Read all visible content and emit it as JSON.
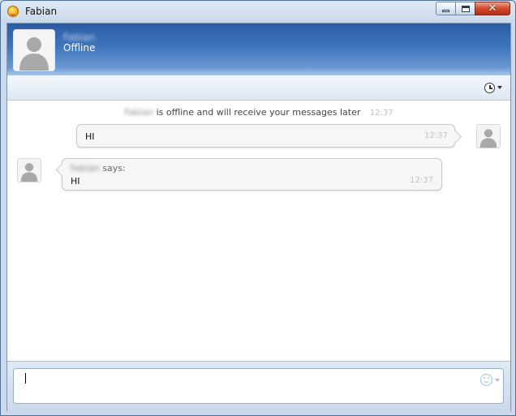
{
  "window": {
    "title": "Fabian",
    "app_icon": "smiley-emoticon-icon",
    "controls": [
      "minimize-icon",
      "maximize-icon",
      "close-icon"
    ]
  },
  "contact": {
    "name": "Fabian",
    "status": "Offline"
  },
  "toolbar": {
    "history_icon": "clock-history-icon"
  },
  "conversation": {
    "system_notice": {
      "name": "Fabian",
      "text": "is offline and will receive your messages later",
      "time": "12:37"
    },
    "outgoing": {
      "text": "HI",
      "time": "12:37"
    },
    "incoming": {
      "sender": "Fabian",
      "says": "says:",
      "text": "HI",
      "time": "12:37"
    }
  },
  "input": {
    "value": "",
    "emoticon_icon": "emoticon-picker-icon"
  }
}
